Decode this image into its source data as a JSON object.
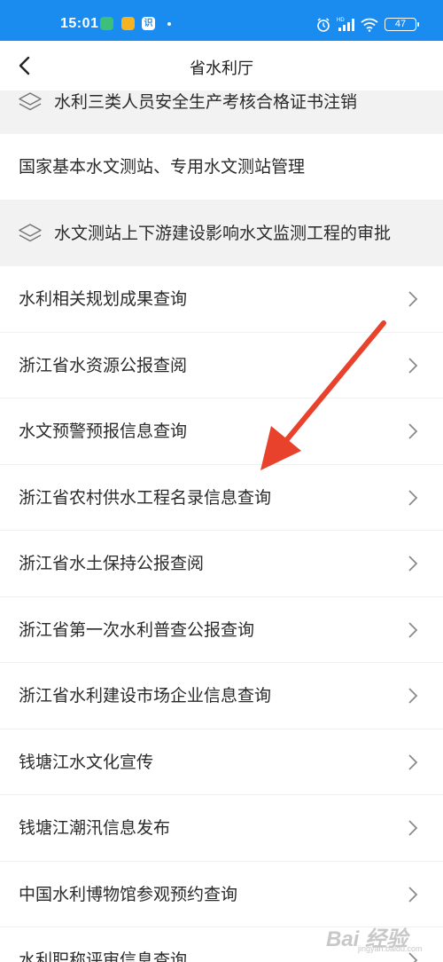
{
  "status_bar": {
    "time": "15:01",
    "battery": "47",
    "app_icon_3": "识"
  },
  "nav": {
    "title": "省水利厅"
  },
  "list": {
    "items": [
      {
        "label": "水利三类人员安全生产考核合格证书注销",
        "style": "grey-layers"
      },
      {
        "label": "国家基本水文测站、专用水文测站管理",
        "style": "white-plain"
      },
      {
        "label": "水文测站上下游建设影响水文监测工程的审批",
        "style": "grey-layers"
      },
      {
        "label": "水利相关规划成果查询",
        "style": "chevron"
      },
      {
        "label": "浙江省水资源公报查阅",
        "style": "chevron"
      },
      {
        "label": "水文预警预报信息查询",
        "style": "chevron"
      },
      {
        "label": "浙江省农村供水工程名录信息查询",
        "style": "chevron"
      },
      {
        "label": "浙江省水土保持公报查阅",
        "style": "chevron"
      },
      {
        "label": "浙江省第一次水利普查公报查询",
        "style": "chevron"
      },
      {
        "label": "浙江省水利建设市场企业信息查询",
        "style": "chevron"
      },
      {
        "label": "钱塘江水文化宣传",
        "style": "chevron"
      },
      {
        "label": "钱塘江潮汛信息发布",
        "style": "chevron"
      },
      {
        "label": "中国水利博物馆参观预约查询",
        "style": "chevron"
      },
      {
        "label": "水利职称评审信息查询",
        "style": "chevron"
      }
    ]
  },
  "watermark": {
    "text": "Bai 经验",
    "sub": "jingyan.baidu.com"
  },
  "colors": {
    "status_bar": "#1a8cf0",
    "annotation_arrow": "#e8412c"
  }
}
